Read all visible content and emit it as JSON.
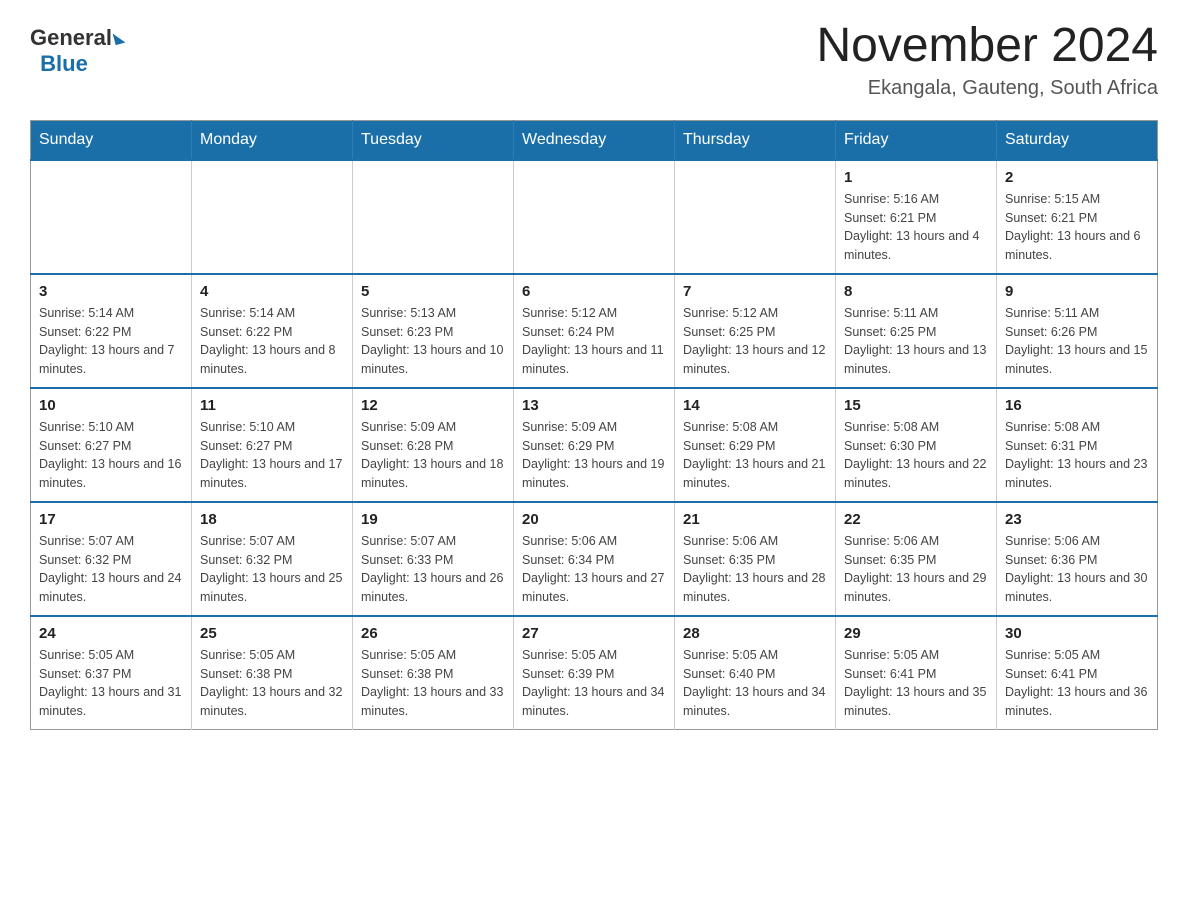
{
  "logo": {
    "general": "General",
    "blue": "Blue"
  },
  "title": "November 2024",
  "location": "Ekangala, Gauteng, South Africa",
  "days_of_week": [
    "Sunday",
    "Monday",
    "Tuesday",
    "Wednesday",
    "Thursday",
    "Friday",
    "Saturday"
  ],
  "weeks": [
    [
      {
        "day": "",
        "info": ""
      },
      {
        "day": "",
        "info": ""
      },
      {
        "day": "",
        "info": ""
      },
      {
        "day": "",
        "info": ""
      },
      {
        "day": "",
        "info": ""
      },
      {
        "day": "1",
        "info": "Sunrise: 5:16 AM\nSunset: 6:21 PM\nDaylight: 13 hours and 4 minutes."
      },
      {
        "day": "2",
        "info": "Sunrise: 5:15 AM\nSunset: 6:21 PM\nDaylight: 13 hours and 6 minutes."
      }
    ],
    [
      {
        "day": "3",
        "info": "Sunrise: 5:14 AM\nSunset: 6:22 PM\nDaylight: 13 hours and 7 minutes."
      },
      {
        "day": "4",
        "info": "Sunrise: 5:14 AM\nSunset: 6:22 PM\nDaylight: 13 hours and 8 minutes."
      },
      {
        "day": "5",
        "info": "Sunrise: 5:13 AM\nSunset: 6:23 PM\nDaylight: 13 hours and 10 minutes."
      },
      {
        "day": "6",
        "info": "Sunrise: 5:12 AM\nSunset: 6:24 PM\nDaylight: 13 hours and 11 minutes."
      },
      {
        "day": "7",
        "info": "Sunrise: 5:12 AM\nSunset: 6:25 PM\nDaylight: 13 hours and 12 minutes."
      },
      {
        "day": "8",
        "info": "Sunrise: 5:11 AM\nSunset: 6:25 PM\nDaylight: 13 hours and 13 minutes."
      },
      {
        "day": "9",
        "info": "Sunrise: 5:11 AM\nSunset: 6:26 PM\nDaylight: 13 hours and 15 minutes."
      }
    ],
    [
      {
        "day": "10",
        "info": "Sunrise: 5:10 AM\nSunset: 6:27 PM\nDaylight: 13 hours and 16 minutes."
      },
      {
        "day": "11",
        "info": "Sunrise: 5:10 AM\nSunset: 6:27 PM\nDaylight: 13 hours and 17 minutes."
      },
      {
        "day": "12",
        "info": "Sunrise: 5:09 AM\nSunset: 6:28 PM\nDaylight: 13 hours and 18 minutes."
      },
      {
        "day": "13",
        "info": "Sunrise: 5:09 AM\nSunset: 6:29 PM\nDaylight: 13 hours and 19 minutes."
      },
      {
        "day": "14",
        "info": "Sunrise: 5:08 AM\nSunset: 6:29 PM\nDaylight: 13 hours and 21 minutes."
      },
      {
        "day": "15",
        "info": "Sunrise: 5:08 AM\nSunset: 6:30 PM\nDaylight: 13 hours and 22 minutes."
      },
      {
        "day": "16",
        "info": "Sunrise: 5:08 AM\nSunset: 6:31 PM\nDaylight: 13 hours and 23 minutes."
      }
    ],
    [
      {
        "day": "17",
        "info": "Sunrise: 5:07 AM\nSunset: 6:32 PM\nDaylight: 13 hours and 24 minutes."
      },
      {
        "day": "18",
        "info": "Sunrise: 5:07 AM\nSunset: 6:32 PM\nDaylight: 13 hours and 25 minutes."
      },
      {
        "day": "19",
        "info": "Sunrise: 5:07 AM\nSunset: 6:33 PM\nDaylight: 13 hours and 26 minutes."
      },
      {
        "day": "20",
        "info": "Sunrise: 5:06 AM\nSunset: 6:34 PM\nDaylight: 13 hours and 27 minutes."
      },
      {
        "day": "21",
        "info": "Sunrise: 5:06 AM\nSunset: 6:35 PM\nDaylight: 13 hours and 28 minutes."
      },
      {
        "day": "22",
        "info": "Sunrise: 5:06 AM\nSunset: 6:35 PM\nDaylight: 13 hours and 29 minutes."
      },
      {
        "day": "23",
        "info": "Sunrise: 5:06 AM\nSunset: 6:36 PM\nDaylight: 13 hours and 30 minutes."
      }
    ],
    [
      {
        "day": "24",
        "info": "Sunrise: 5:05 AM\nSunset: 6:37 PM\nDaylight: 13 hours and 31 minutes."
      },
      {
        "day": "25",
        "info": "Sunrise: 5:05 AM\nSunset: 6:38 PM\nDaylight: 13 hours and 32 minutes."
      },
      {
        "day": "26",
        "info": "Sunrise: 5:05 AM\nSunset: 6:38 PM\nDaylight: 13 hours and 33 minutes."
      },
      {
        "day": "27",
        "info": "Sunrise: 5:05 AM\nSunset: 6:39 PM\nDaylight: 13 hours and 34 minutes."
      },
      {
        "day": "28",
        "info": "Sunrise: 5:05 AM\nSunset: 6:40 PM\nDaylight: 13 hours and 34 minutes."
      },
      {
        "day": "29",
        "info": "Sunrise: 5:05 AM\nSunset: 6:41 PM\nDaylight: 13 hours and 35 minutes."
      },
      {
        "day": "30",
        "info": "Sunrise: 5:05 AM\nSunset: 6:41 PM\nDaylight: 13 hours and 36 minutes."
      }
    ]
  ]
}
